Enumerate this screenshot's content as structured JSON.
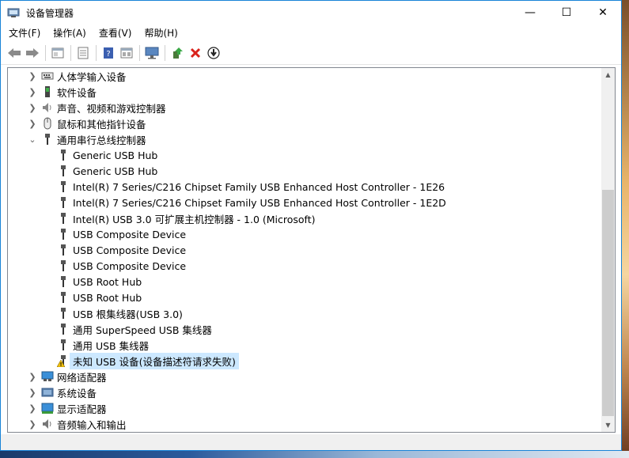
{
  "window": {
    "title": "设备管理器",
    "minimize": "—",
    "maximize": "☐",
    "close": "✕"
  },
  "menu": [
    {
      "label": "文件(F)"
    },
    {
      "label": "操作(A)"
    },
    {
      "label": "查看(V)"
    },
    {
      "label": "帮助(H)"
    }
  ],
  "toolbar": {
    "buttons": [
      "back-icon",
      "forward-icon",
      "properties-icon",
      "list-icon",
      "help-icon",
      "view-icon",
      "monitor-icon",
      "update-driver-icon",
      "uninstall-icon",
      "disable-icon"
    ]
  },
  "tree": {
    "categories": [
      {
        "label": "人体学输入设备",
        "expanded": false,
        "icon": "hid-icon"
      },
      {
        "label": "软件设备",
        "expanded": false,
        "icon": "software-device-icon"
      },
      {
        "label": "声音、视频和游戏控制器",
        "expanded": false,
        "icon": "sound-icon"
      },
      {
        "label": "鼠标和其他指针设备",
        "expanded": false,
        "icon": "mouse-icon"
      },
      {
        "label": "通用串行总线控制器",
        "expanded": true,
        "icon": "usb-icon"
      }
    ],
    "usb_children": [
      {
        "label": "Generic USB Hub"
      },
      {
        "label": "Generic USB Hub"
      },
      {
        "label": "Intel(R) 7 Series/C216 Chipset Family USB Enhanced Host Controller - 1E26"
      },
      {
        "label": "Intel(R) 7 Series/C216 Chipset Family USB Enhanced Host Controller - 1E2D"
      },
      {
        "label": "Intel(R) USB 3.0 可扩展主机控制器 - 1.0 (Microsoft)"
      },
      {
        "label": "USB Composite Device"
      },
      {
        "label": "USB Composite Device"
      },
      {
        "label": "USB Composite Device"
      },
      {
        "label": "USB Root Hub"
      },
      {
        "label": "USB Root Hub"
      },
      {
        "label": "USB 根集线器(USB 3.0)"
      },
      {
        "label": "通用 SuperSpeed USB 集线器"
      },
      {
        "label": "通用 USB 集线器"
      },
      {
        "label": "未知 USB 设备(设备描述符请求失败)",
        "warning": true
      }
    ],
    "after_categories": [
      {
        "label": "网络适配器",
        "icon": "network-adapter-icon"
      },
      {
        "label": "系统设备",
        "icon": "system-device-icon"
      },
      {
        "label": "显示适配器",
        "icon": "display-adapter-icon"
      },
      {
        "label": "音频输入和输出",
        "icon": "audio-io-icon"
      }
    ]
  },
  "colors": {
    "accent": "#1883d7",
    "selection": "#cce8ff",
    "warning": "#f4c20d"
  }
}
